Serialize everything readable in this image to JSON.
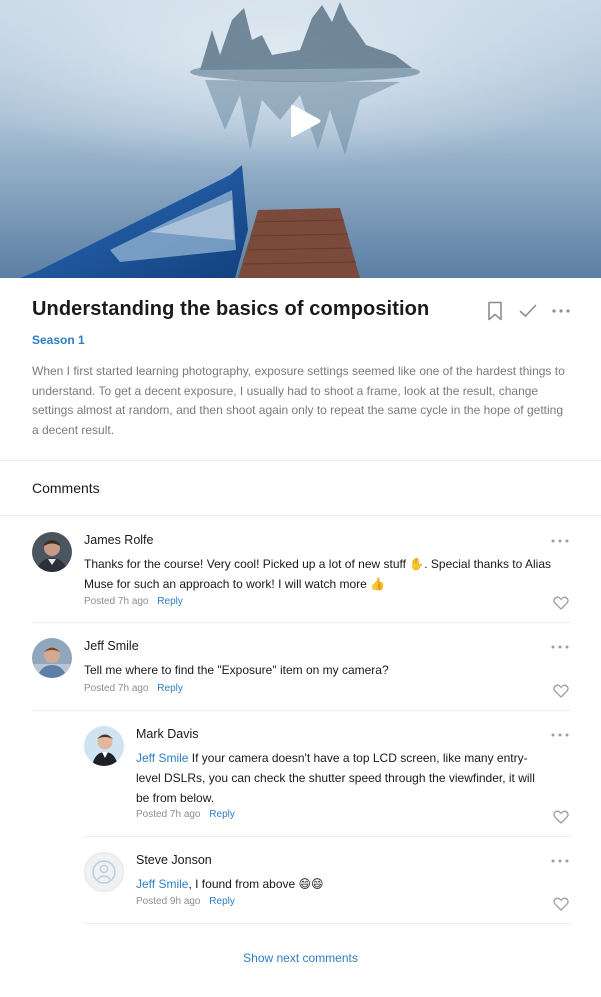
{
  "video": {
    "play_icon": "play-icon"
  },
  "lesson": {
    "title": "Understanding the basics of composition",
    "season": "Season 1",
    "description": "When I first started learning photography, exposure settings seemed like one of the hardest things to understand. To get a decent exposure, I usually had to shoot a frame, look at the result, change settings almost at random, and then shoot again only to repeat the same cycle in the hope of getting a decent result.",
    "actions": [
      "bookmark-icon",
      "check-icon",
      "more-icon"
    ]
  },
  "comments_section": {
    "heading": "Comments",
    "show_next_label": "Show next comments"
  },
  "comments": [
    {
      "author": "James Rolfe",
      "text": "Thanks for the course! Very cool! Picked up a lot of new stuff",
      "emoji_1": "✋",
      "text_2": ". Special thanks to Alias",
      "text_3": "Muse for such an approach to work! I will watch more",
      "emoji_2": "👍",
      "posted": "Posted 7h ago",
      "reply_label": "Reply"
    },
    {
      "author": "Jeff Smile",
      "text": "Tell me where to find the \"Exposure\" item on my camera?",
      "posted": "Posted 7h ago",
      "reply_label": "Reply"
    }
  ],
  "replies": [
    {
      "author": "Mark Davis",
      "mention": "Jeff Smile",
      "text_1": " If your camera doesn't have a top LCD screen, like many entry-",
      "text_2": "level DSLRs, you can check the shutter speed through the viewfinder, it will",
      "text_3": "be from below.",
      "posted": "Posted 7h ago",
      "reply_label": "Reply"
    },
    {
      "author": "Steve Jonson",
      "mention": "Jeff Smile",
      "text_1": ", I found from above",
      "emoji": "😄😄",
      "posted": "Posted 9h ago",
      "reply_label": "Reply"
    }
  ],
  "colors": {
    "accent": "#2d7dc3",
    "muted_text": "#777b80",
    "divider": "#ececec"
  }
}
